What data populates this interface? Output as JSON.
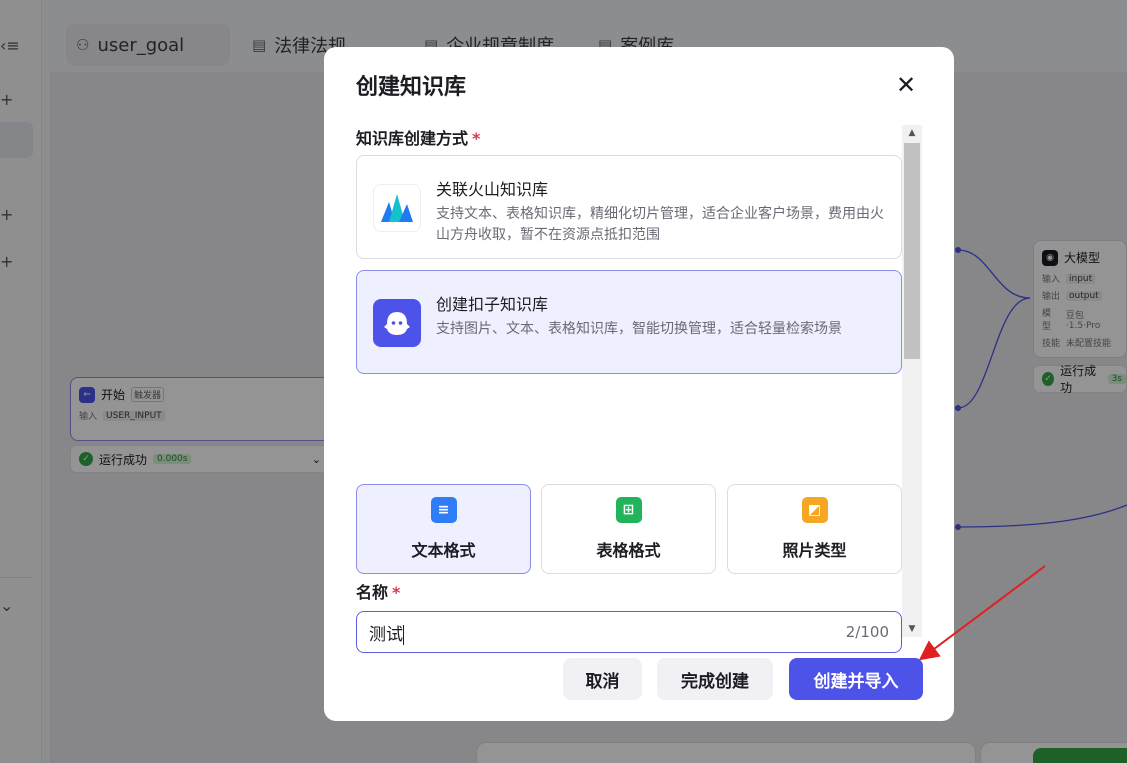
{
  "tabs": [
    {
      "label": "user_goal"
    },
    {
      "label": "法律法规"
    },
    {
      "label": "企业规章制度"
    },
    {
      "label": "案例库"
    }
  ],
  "canvas": {
    "start_node": {
      "title": "开始",
      "tag": "触发器",
      "input_label": "输入",
      "input_value": "USER_INPUT"
    },
    "start_status": {
      "text": "运行成功",
      "time": "0.000s"
    },
    "llm_node": {
      "title": "大模型",
      "input_label": "输入",
      "input_value": "input",
      "output_label": "输出",
      "output_value": "output",
      "model_label": "模型",
      "model_value": "豆包·1.5·Pro",
      "skill_label": "技能",
      "skill_value": "未配置技能"
    },
    "llm_status": {
      "text": "运行成功",
      "time": "3s"
    }
  },
  "modal": {
    "title": "创建知识库",
    "method_label": "知识库创建方式",
    "required_mark": "*",
    "options": [
      {
        "title": "关联火山知识库",
        "desc": "支持文本、表格知识库，精细化切片管理，适合企业客户场景，费用由火山方舟收取，暂不在资源点抵扣范围",
        "selected": false
      },
      {
        "title": "创建扣子知识库",
        "desc": "支持图片、文本、表格知识库，智能切换管理，适合轻量检索场景",
        "selected": true
      }
    ],
    "formats": [
      {
        "label": "文本格式",
        "icon": "text-doc-icon",
        "color": "#2f7cf6",
        "selected": true
      },
      {
        "label": "表格格式",
        "icon": "table-icon",
        "color": "#22b45a",
        "selected": false
      },
      {
        "label": "照片类型",
        "icon": "image-icon",
        "color": "#f5a623",
        "selected": false
      }
    ],
    "name_label": "名称",
    "name_value": "测试",
    "name_count": "2/100",
    "buttons": {
      "cancel": "取消",
      "finish": "完成创建",
      "import": "创建并导入"
    }
  },
  "colors": {
    "accent": "#4d53e8",
    "required": "#e5334b",
    "success": "#32a645",
    "annotation_arrow": "#e02020"
  }
}
